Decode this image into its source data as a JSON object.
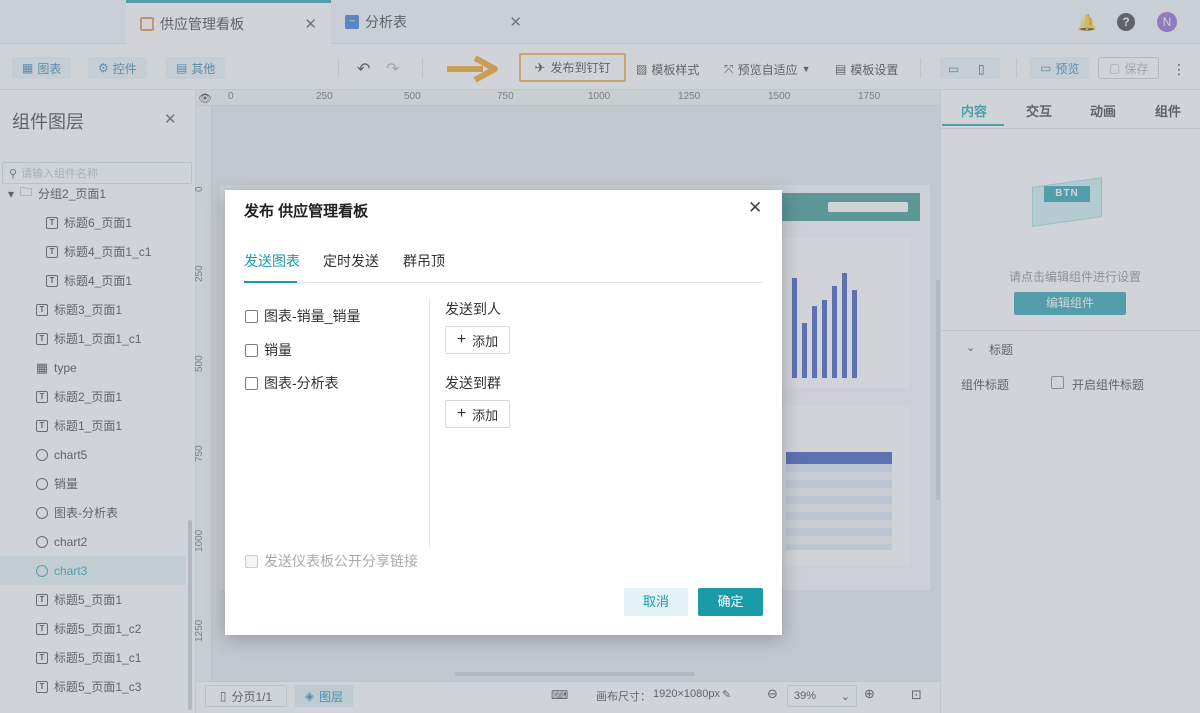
{
  "tabs": [
    {
      "label": "供应管理看板",
      "icon": "dashboard-icon"
    },
    {
      "label": "分析表",
      "icon": "line-chart-icon"
    }
  ],
  "header": {
    "avatar_letter": "N"
  },
  "toolbar": {
    "chart_label": "图表",
    "control_label": "控件",
    "other_label": "其他",
    "publish_label": "发布到钉钉",
    "template_style_label": "模板样式",
    "preview_adapt_label": "预览自适应",
    "template_settings_label": "模板设置",
    "preview_label": "预览",
    "save_label": "保存"
  },
  "left_panel": {
    "title": "组件图层",
    "search_placeholder": "请输入组件名称",
    "layers": [
      {
        "label": "分组2_页面1",
        "type": "folder",
        "indent": 0
      },
      {
        "label": "标题6_页面1",
        "type": "text",
        "indent": 2
      },
      {
        "label": "标题4_页面1_c1",
        "type": "text",
        "indent": 2
      },
      {
        "label": "标题4_页面1",
        "type": "text",
        "indent": 2
      },
      {
        "label": "标题3_页面1",
        "type": "text",
        "indent": 1
      },
      {
        "label": "标题1_页面1_c1",
        "type": "text",
        "indent": 1
      },
      {
        "label": "type",
        "type": "table",
        "indent": 1
      },
      {
        "label": "标题2_页面1",
        "type": "text",
        "indent": 1
      },
      {
        "label": "标题1_页面1",
        "type": "text",
        "indent": 1
      },
      {
        "label": "chart5",
        "type": "chart",
        "indent": 1
      },
      {
        "label": "销量",
        "type": "chart",
        "indent": 1
      },
      {
        "label": "图表-分析表",
        "type": "chart",
        "indent": 1
      },
      {
        "label": "chart2",
        "type": "chart",
        "indent": 1
      },
      {
        "label": "chart3",
        "type": "chart",
        "indent": 1,
        "selected": true
      },
      {
        "label": "标题5_页面1",
        "type": "text",
        "indent": 1
      },
      {
        "label": "标题5_页面1_c2",
        "type": "text",
        "indent": 1
      },
      {
        "label": "标题5_页面1_c1",
        "type": "text",
        "indent": 1
      },
      {
        "label": "标题5_页面1_c3",
        "type": "text",
        "indent": 1
      }
    ]
  },
  "ruler": {
    "top": [
      "0",
      "250",
      "500",
      "750",
      "1000",
      "1250",
      "1500",
      "1750"
    ],
    "left": [
      "0",
      "250",
      "500",
      "750",
      "1000",
      "1250"
    ]
  },
  "bottom_bar": {
    "page_label": "分页1/1",
    "layer_label": "图层",
    "canvas_size_label": "画布尺寸：",
    "canvas_size_value": "1920×1080px",
    "zoom_value": "39%"
  },
  "right_panel": {
    "tabs": [
      "内容",
      "交互",
      "动画",
      "组件"
    ],
    "hint": "请点击编辑组件进行设置",
    "edit_button": "编辑组件",
    "section_title": "标题",
    "component_title_label": "组件标题",
    "enable_title_label": "开启组件标题",
    "btn_illustration_text": "BTN"
  },
  "modal": {
    "title": "发布 供应管理看板",
    "tabs": [
      "发送图表",
      "定时发送",
      "群吊顶"
    ],
    "active_tab": 0,
    "charts": [
      {
        "label": "图表-销量_销量",
        "checked": false
      },
      {
        "label": "销量",
        "checked": false
      },
      {
        "label": "图表-分析表",
        "checked": false
      }
    ],
    "send_to_person_label": "发送到人",
    "send_to_group_label": "发送到群",
    "add_label": "添加",
    "share_link_label": "发送仪表板公开分享链接",
    "cancel_label": "取消",
    "confirm_label": "确定"
  },
  "colors": {
    "accent": "#1a9ca8",
    "highlight": "#f0a93a",
    "arrow": "#f39c12"
  }
}
